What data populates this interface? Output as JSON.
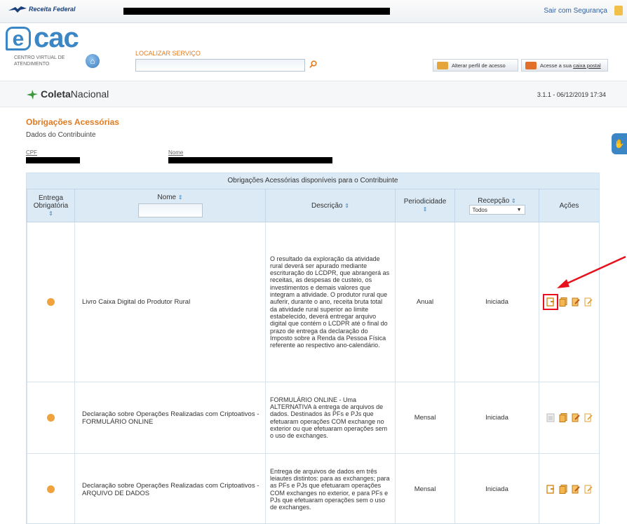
{
  "topbar": {
    "brand": "Receita Federal",
    "logout": "Sair com Segurança"
  },
  "header": {
    "logo_main": "cac",
    "logo_letter": "e",
    "logo_sub": "CENTRO VIRTUAL DE ATENDIMENTO",
    "search_label": "LOCALIZAR SERVIÇO",
    "search_value": "",
    "profile_button": "Alterar perfil de acesso",
    "mailbox_button_prefix": "Acesse a sua ",
    "mailbox_button_link": "caixa postal"
  },
  "coleta": {
    "brand_a": "Coleta",
    "brand_b": "Nacional",
    "version": "3.1.1 - 06/12/2019 17:34"
  },
  "page": {
    "title": "Obrigações Acessórias",
    "subtitle": "Dados do Contribuinte",
    "cpf_label": "CPF",
    "name_label": "Nome"
  },
  "table": {
    "caption": "Obrigações Acessórias disponíveis para o Contribuinte",
    "headers": {
      "mandatory": "Entrega Obrigatória",
      "name": "Nome",
      "description": "Descrição",
      "periodicity": "Periodicidade",
      "reception": "Recepção",
      "actions": "Ações"
    },
    "reception_filter": "Todos",
    "rows": [
      {
        "name": "Livro Caixa Digital do Produtor Rural",
        "description": "O resultado da exploração da atividade rural deverá ser apurado mediante escrituração do LCDPR, que abrangerá as receitas, as despesas de custeio, os investimentos e demais valores que integram a atividade. O produtor rural que auferir, durante o ano, receita bruta total da atividade rural superior ao limite estabelecido, deverá entregar arquivo digital que contém o LCDPR até o final do prazo de entrega da declaração do Imposto sobre a Renda da Pessoa Física referente ao respectivo ano-calendário.",
        "periodicity": "Anual",
        "reception": "Iniciada"
      },
      {
        "name": "Declaração sobre Operações Realizadas com Criptoativos - FORMULÁRIO ONLINE",
        "description": "FORMULÁRIO ONLINE - Uma ALTERNATIVA à entrega de arquivos de dados. Destinados às PFs e PJs que efetuaram operações COM exchange no exterior ou que efetuaram operações sem o uso de exchanges.",
        "periodicity": "Mensal",
        "reception": "Iniciada"
      },
      {
        "name": "Declaração sobre Operações Realizadas com Criptoativos - ARQUIVO DE DADOS",
        "description": "Entrega de arquivos de dados em três leiautes distintos: para as exchanges; para as PFs e PJs que efetuaram operações COM exchanges no exterior, e para PFs e PJs que efetuaram operações sem o uso de exchanges.",
        "periodicity": "Mensal",
        "reception": "Iniciada"
      }
    ]
  },
  "colors": {
    "accent_orange": "#e07b22",
    "brand_blue": "#3b86c4",
    "header_blue": "#dceaf5",
    "highlight_red": "#e8101c"
  }
}
